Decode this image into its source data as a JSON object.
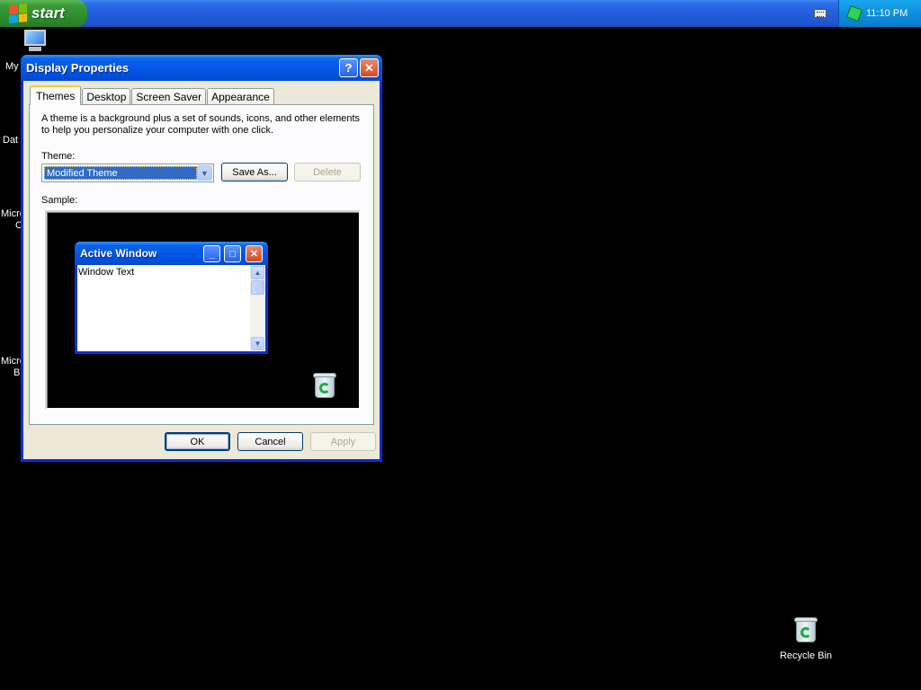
{
  "taskbar": {
    "start_label": "start",
    "clock": "11:10 PM"
  },
  "desktop": {
    "icon_labels": [
      "My",
      "Dat",
      "Micro",
      "C",
      "Micro",
      "B"
    ],
    "recycle_bin_label": "Recycle Bin"
  },
  "dialog": {
    "title": "Display Properties",
    "help_symbol": "?",
    "close_symbol": "✕",
    "tabs": [
      "Themes",
      "Desktop",
      "Screen Saver",
      "Appearance"
    ],
    "active_tab": "Themes",
    "description": "A theme is a background plus a set of sounds, icons, and other elements to help you personalize your computer with one click.",
    "theme_label": "Theme:",
    "theme_value": "Modified Theme",
    "save_as_label": "Save As...",
    "delete_label": "Delete",
    "sample_label": "Sample:",
    "sample_window": {
      "title": "Active Window",
      "text": "Window Text"
    },
    "ok_label": "OK",
    "cancel_label": "Cancel",
    "apply_label": "Apply"
  },
  "colors": {
    "title_bar": "#0055e5",
    "taskbar": "#235fd9",
    "start_button": "#3d9c3a",
    "selection": "#316ac5",
    "dialog_face": "#ece9d8",
    "desktop_background": "#000000"
  },
  "icons": [
    "windows-logo-icon",
    "keyboard-icon",
    "network-icon",
    "my-computer-icon",
    "recycle-bin-icon",
    "help-icon",
    "close-icon",
    "minimize-icon",
    "maximize-icon",
    "chevron-down-icon"
  ]
}
